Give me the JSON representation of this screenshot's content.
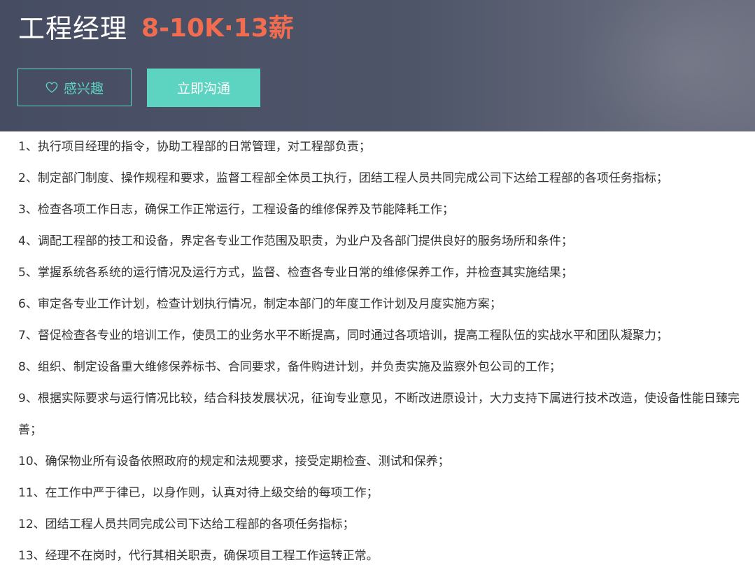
{
  "header": {
    "job_title": "工程经理",
    "salary": "8-10K·13薪",
    "interest_label": "感兴趣",
    "chat_label": "立即沟通",
    "colors": {
      "accent": "#5dd3c2",
      "salary": "#f26d4f",
      "background": "#4f5569"
    }
  },
  "duties": [
    "1、执行项目经理的指令，协助工程部的日常管理，对工程部负责；",
    "2、制定部门制度、操作规程和要求，监督工程部全体员工执行，团结工程人员共同完成公司下达给工程部的各项任务指标；",
    "3、检查各项工作日志，确保工作正常运行，工程设备的维修保养及节能降耗工作；",
    "4、调配工程部的技工和设备，界定各专业工作范围及职责，为业户及各部门提供良好的服务场所和条件；",
    "5、掌握系统各系统的运行情况及运行方式，监督、检查各专业日常的维修保养工作，并检查其实施结果；",
    "6、审定各专业工作计划，检查计划执行情况，制定本部门的年度工作计划及月度实施方案；",
    "7、督促检查各专业的培训工作，使员工的业务水平不断提高，同时通过各项培训，提高工程队伍的实战水平和团队凝聚力；",
    "8、组织、制定设备重大维修保养标书、合同要求，备件购进计划，并负责实施及监察外包公司的工作；",
    "9、根据实际要求与运行情况比较，结合科技发展状况，征询专业意见，不断改进原设计，大力支持下属进行技术改造，使设备性能日臻完善；",
    "10、确保物业所有设备依照政府的规定和法规要求，接受定期检查、测试和保养；",
    "11、在工作中严于律已，以身作则，认真对待上级交给的每项工作；",
    "12、团结工程人员共同完成公司下达给工程部的各项任务指标；",
    "13、经理不在岗时，代行其相关职责，确保项目工程工作运转正常。"
  ]
}
